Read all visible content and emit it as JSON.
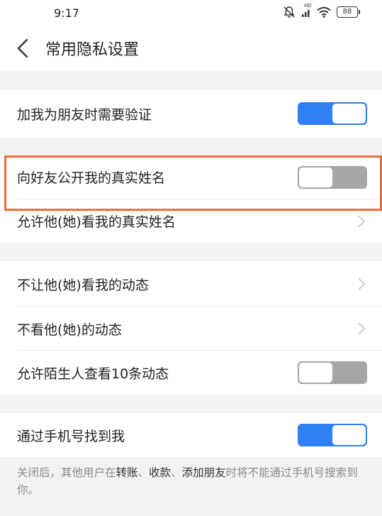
{
  "status_bar": {
    "time": "9:17",
    "battery": "88",
    "hd_label": "HD"
  },
  "header": {
    "title": "常用隐私设置"
  },
  "settings": {
    "verify_friend": {
      "label": "加我为朋友时需要验证",
      "enabled": true
    },
    "show_real_name": {
      "label": "向好友公开我的真实姓名",
      "enabled": false
    },
    "allow_view_real_name": {
      "label": "允许他(她)看我的真实姓名"
    },
    "hide_my_moments": {
      "label": "不让他(她)看我的动态"
    },
    "hide_their_moments": {
      "label": "不看他(她)的动态"
    },
    "stranger_view_10": {
      "label": "允许陌生人查看10条动态",
      "enabled": false
    },
    "find_by_phone": {
      "label": "通过手机号找到我",
      "enabled": true
    }
  },
  "note": {
    "part1": "关闭后，其他用户在",
    "highlight1": "转账",
    "sep1": "、",
    "highlight2": "收款",
    "sep2": "、",
    "highlight3": "添加朋友",
    "part2": "时将不能通过手机号搜索到你。"
  },
  "colors": {
    "toggle_on": "#2f80f4",
    "toggle_off": "#a6a6a6",
    "highlight_border": "#f26b3a",
    "background": "#f2f2f2"
  }
}
